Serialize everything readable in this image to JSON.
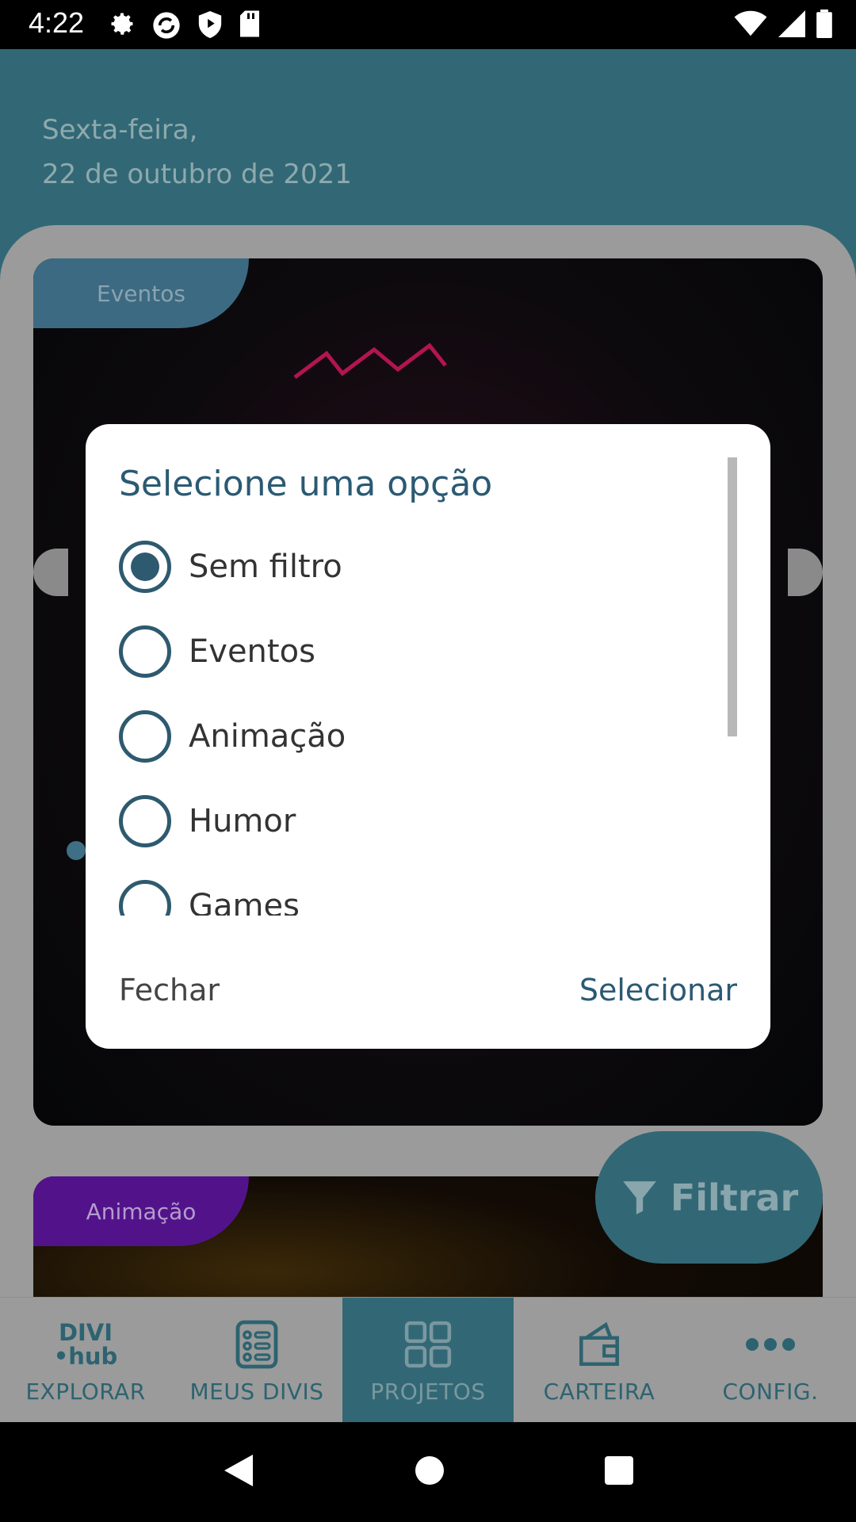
{
  "status_bar": {
    "time": "4:22",
    "icons_left": [
      "settings-icon",
      "sync-icon",
      "shield-icon",
      "sd-card-icon"
    ],
    "icons_right": [
      "wifi-icon",
      "signal-icon",
      "battery-icon"
    ]
  },
  "header": {
    "weekday": "Sexta-feira,",
    "date": "22 de outubro de 2021"
  },
  "cards": [
    {
      "tag": "Eventos",
      "tag_color": "#3c6a82"
    },
    {
      "tag": "Animação",
      "tag_color": "#52138a"
    }
  ],
  "fab": {
    "label": "Filtrar",
    "icon": "filter-icon"
  },
  "bottom_nav": {
    "items": [
      {
        "label": "EXPLORAR",
        "icon": "divi-hub-logo",
        "logo_line1": "DIVI",
        "logo_line2": "•hub"
      },
      {
        "label": "MEUS DIVIS",
        "icon": "list-icon"
      },
      {
        "label": "PROJETOS",
        "icon": "grid-icon",
        "active": true
      },
      {
        "label": "CARTEIRA",
        "icon": "wallet-icon"
      },
      {
        "label": "CONFIG.",
        "icon": "more-icon"
      }
    ]
  },
  "dialog": {
    "title": "Selecione uma opção",
    "options": [
      {
        "label": "Sem filtro",
        "selected": true
      },
      {
        "label": "Eventos",
        "selected": false
      },
      {
        "label": "Animação",
        "selected": false
      },
      {
        "label": "Humor",
        "selected": false
      },
      {
        "label": "Games",
        "selected": false
      }
    ],
    "close_label": "Fechar",
    "select_label": "Selecionar"
  },
  "colors": {
    "primary": "#326875",
    "dialog_accent": "#2b5a73",
    "scrim": "#9b9b9b"
  }
}
